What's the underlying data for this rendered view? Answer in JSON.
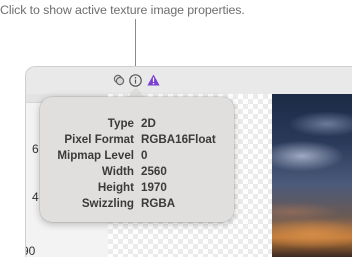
{
  "caption": "Click to show active texture image properties.",
  "toolbar": {
    "icons": [
      "layers-icon",
      "info-icon",
      "warning-icon"
    ],
    "warning_color": "#7b3fd1"
  },
  "left_panel": {
    "partial_numbers": [
      "6",
      "4",
      "90"
    ]
  },
  "properties": [
    {
      "key": "Type",
      "value": "2D"
    },
    {
      "key": "Pixel Format",
      "value": "RGBA16Float"
    },
    {
      "key": "Mipmap Level",
      "value": "0"
    },
    {
      "key": "Width",
      "value": "2560"
    },
    {
      "key": "Height",
      "value": "1970"
    },
    {
      "key": "Swizzling",
      "value": "RGBA"
    }
  ]
}
